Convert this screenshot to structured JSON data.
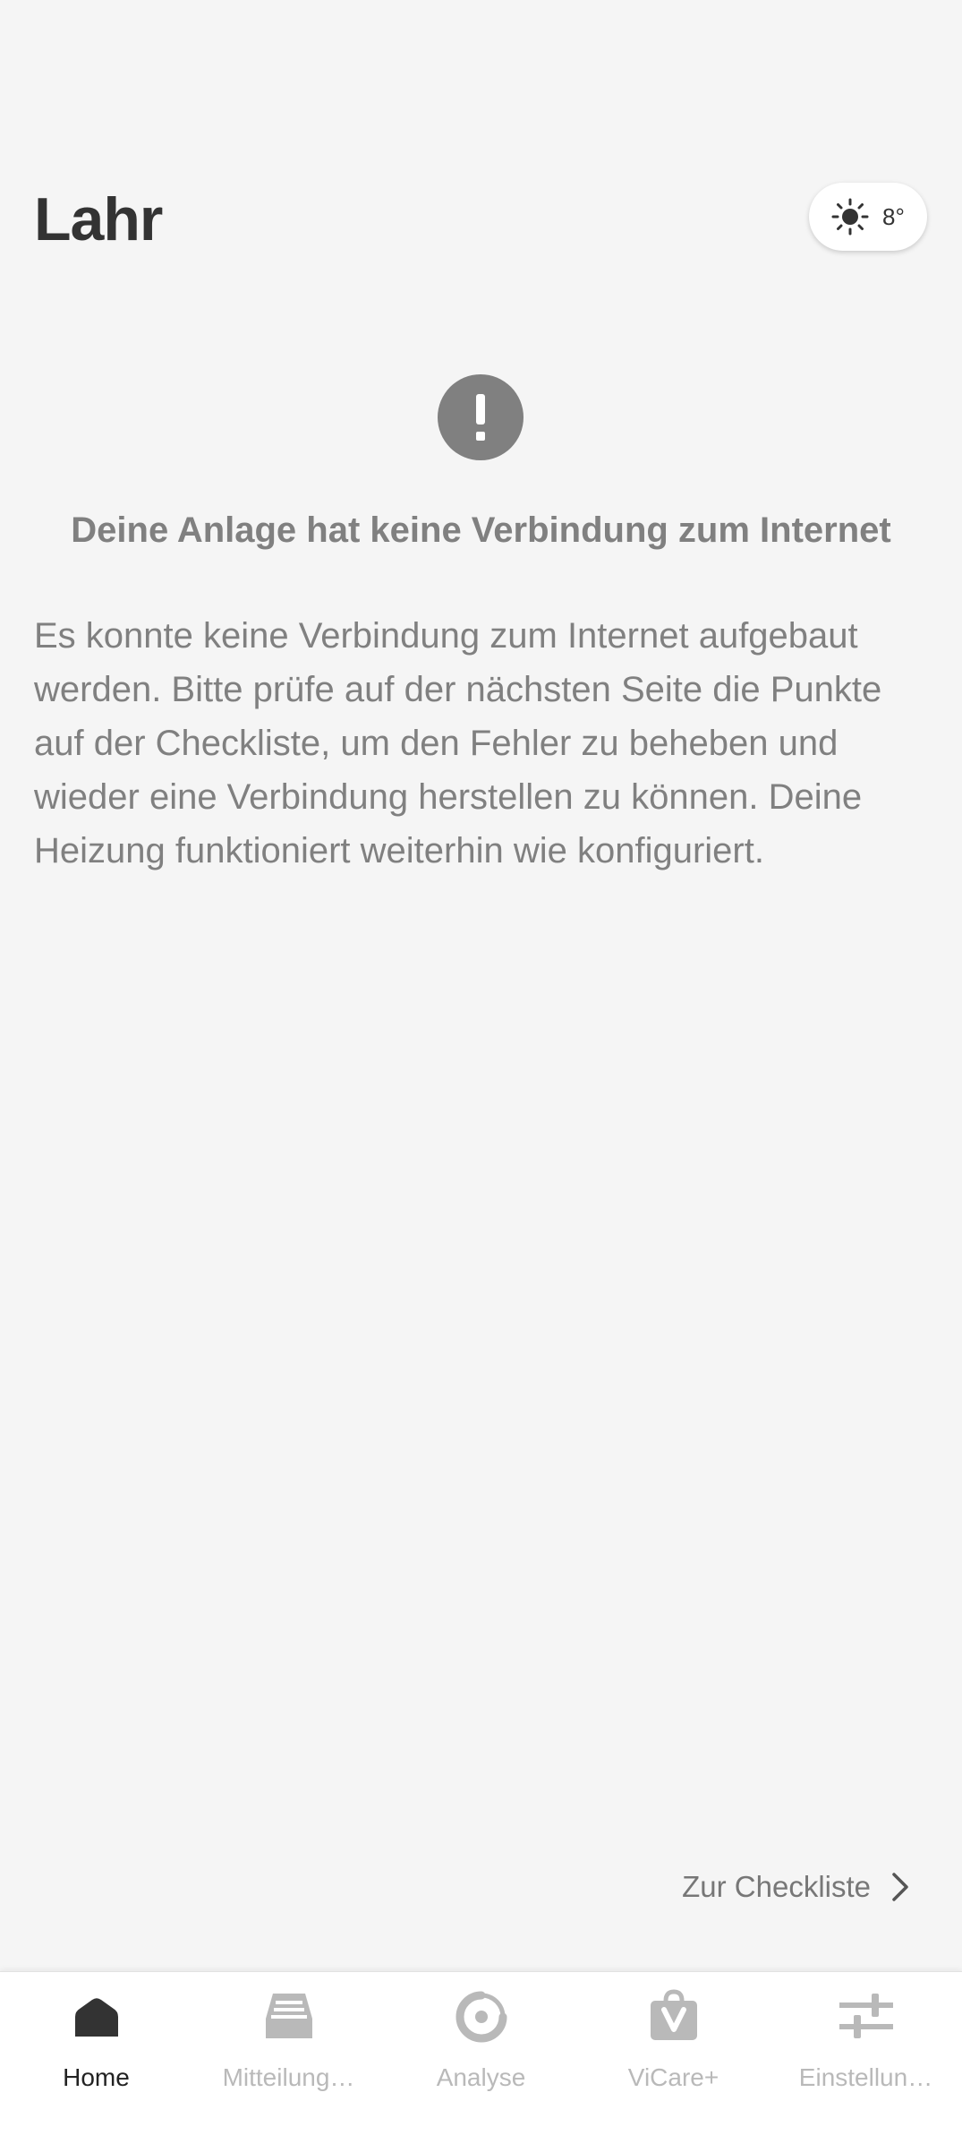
{
  "header": {
    "title": "Lahr",
    "weather": {
      "icon": "sun-icon",
      "temperature": "8°"
    }
  },
  "alert": {
    "icon": "exclamation-icon",
    "title": "Deine Anlage hat keine Verbindung zum Internet",
    "text": "Es konnte keine Verbindung zum Internet aufgebaut werden. Bitte prüfe auf der nächsten Seite die Punkte auf der Checkliste, um den Fehler zu beheben und wieder eine Verbindung herstellen zu können. Deine Heizung funktioniert weiterhin wie konfiguriert."
  },
  "checklist_link": {
    "label": "Zur Checkliste",
    "icon": "chevron-right-icon"
  },
  "bottom_nav": {
    "items": [
      {
        "label": "Home",
        "icon": "home-icon",
        "active": true
      },
      {
        "label": "Mitteilung…",
        "icon": "inbox-icon",
        "active": false
      },
      {
        "label": "Analyse",
        "icon": "analysis-icon",
        "active": false
      },
      {
        "label": "ViCare+",
        "icon": "shopping-bag-icon",
        "active": false
      },
      {
        "label": "Einstellun…",
        "icon": "settings-sliders-icon",
        "active": false
      }
    ]
  },
  "colors": {
    "background": "#f5f5f5",
    "title_text": "#333333",
    "muted_text": "#808080",
    "nav_active": "#222222",
    "nav_inactive": "#b9b9b9",
    "alert_icon_bg": "#808080"
  }
}
